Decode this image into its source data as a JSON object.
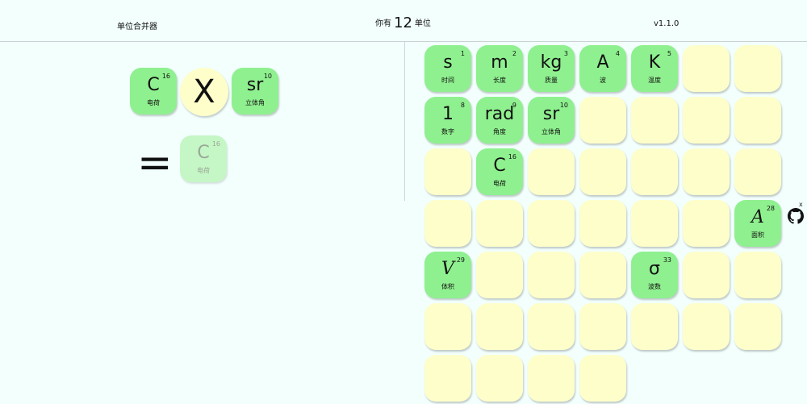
{
  "header": {
    "title": "单位合并器",
    "count_prefix": "你有",
    "count": "12",
    "count_suffix": "单位",
    "version": "v1.1.0"
  },
  "merge": {
    "left": {
      "symbol": "C",
      "index": "16",
      "label": "电荷"
    },
    "operator": "X",
    "right": {
      "symbol": "sr",
      "index": "10",
      "label": "立体角"
    },
    "equals": "=",
    "result": {
      "symbol": "C",
      "index": "16",
      "label": "电荷"
    }
  },
  "grid": {
    "rows": [
      [
        {
          "symbol": "s",
          "index": "1",
          "label": "时间"
        },
        {
          "symbol": "m",
          "index": "2",
          "label": "长度"
        },
        {
          "symbol": "kg",
          "index": "3",
          "label": "质量"
        },
        {
          "symbol": "A",
          "index": "4",
          "label": "波"
        },
        {
          "symbol": "K",
          "index": "5",
          "label": "温度"
        },
        null,
        null
      ],
      [
        {
          "symbol": "1",
          "index": "8",
          "label": "数字"
        },
        {
          "symbol": "rad",
          "index": "9",
          "label": "角度"
        },
        {
          "symbol": "sr",
          "index": "10",
          "label": "立体角"
        },
        null,
        null,
        null,
        null
      ],
      [
        null,
        {
          "symbol": "C",
          "index": "16",
          "label": "电荷"
        },
        null,
        null,
        null,
        null,
        null
      ],
      [
        null,
        null,
        null,
        null,
        null,
        null,
        {
          "symbol": "A",
          "index": "28",
          "label": "面积",
          "italic": true
        }
      ],
      [
        {
          "symbol": "V",
          "index": "29",
          "label": "体积",
          "italic": true
        },
        null,
        null,
        null,
        {
          "symbol": "σ",
          "index": "33",
          "label": "波数"
        },
        null,
        null
      ],
      [
        null,
        null,
        null,
        null,
        null,
        null,
        null
      ],
      [
        null,
        null,
        null,
        null
      ]
    ]
  },
  "side": {
    "close": "x",
    "icon": "github-icon"
  },
  "colors": {
    "background": "#f2fffd",
    "unit_tile": "#8ff08f",
    "empty_tile": "#fefecb",
    "ghost_tile": "#c5f6c5"
  }
}
